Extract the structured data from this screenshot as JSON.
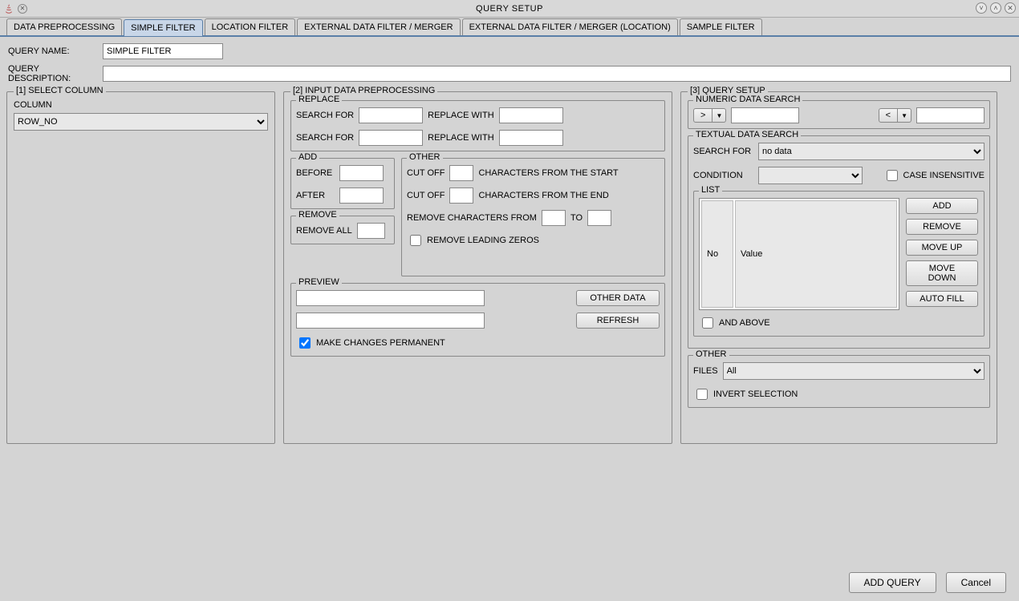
{
  "window": {
    "title": "QUERY SETUP"
  },
  "tabs": [
    "DATA PREPROCESSING",
    "SIMPLE FILTER",
    "LOCATION FILTER",
    "EXTERNAL DATA FILTER / MERGER",
    "EXTERNAL DATA FILTER / MERGER (LOCATION)",
    "SAMPLE FILTER"
  ],
  "selected_tab": 1,
  "top": {
    "query_name_label": "QUERY NAME:",
    "query_name_value": "SIMPLE FILTER",
    "query_desc_label": "QUERY DESCRIPTION:",
    "query_desc_value": ""
  },
  "p1": {
    "title": "[1] SELECT COLUMN",
    "column_label": "COLUMN",
    "column_value": "ROW_NO"
  },
  "p2": {
    "title": "[2] INPUT DATA PREPROCESSING",
    "replace": {
      "title": "REPLACE",
      "search_for": "SEARCH FOR",
      "replace_with": "REPLACE WITH",
      "v1a": "",
      "v1b": "",
      "v2a": "",
      "v2b": ""
    },
    "add": {
      "title": "ADD",
      "before": "BEFORE",
      "after": "AFTER",
      "bv": "",
      "av": ""
    },
    "remove": {
      "title": "REMOVE",
      "remove_all": "REMOVE ALL",
      "rv": ""
    },
    "other": {
      "title": "OTHER",
      "cut_off": "CUT OFF",
      "chars_start": "CHARACTERS FROM THE START",
      "chars_end": "CHARACTERS FROM THE END",
      "remove_chars_from": "REMOVE CHARACTERS FROM",
      "to": "TO",
      "remove_leading_zeros": "REMOVE LEADING ZEROS",
      "c1": "",
      "c2": "",
      "r1": "",
      "r2": ""
    },
    "preview": {
      "title": "PREVIEW",
      "t1": "",
      "t2": "",
      "other_data": "OTHER DATA",
      "refresh": "REFRESH",
      "make_permanent": "MAKE CHANGES PERMANENT"
    }
  },
  "p3": {
    "title": "[3] QUERY SETUP",
    "numeric": {
      "title": "NUMERIC DATA SEARCH",
      "gt": ">",
      "lt": "<",
      "v1": "",
      "v2": ""
    },
    "textual": {
      "title": "TEXTUAL DATA SEARCH",
      "search_for": "SEARCH FOR",
      "search_for_value": "no data",
      "condition": "CONDITION",
      "condition_value": "",
      "case_insensitive": "CASE INSENSITIVE",
      "list": "LIST",
      "col_no": "No",
      "col_value": "Value",
      "add": "ADD",
      "remove": "REMOVE",
      "move_up": "MOVE UP",
      "move_down": "MOVE DOWN",
      "auto_fill": "AUTO FILL",
      "and_above": "AND ABOVE"
    },
    "other": {
      "title": "OTHER",
      "files": "FILES",
      "files_value": "All",
      "invert": "INVERT SELECTION"
    }
  },
  "bottom": {
    "add_query": "ADD QUERY",
    "cancel": "Cancel"
  }
}
